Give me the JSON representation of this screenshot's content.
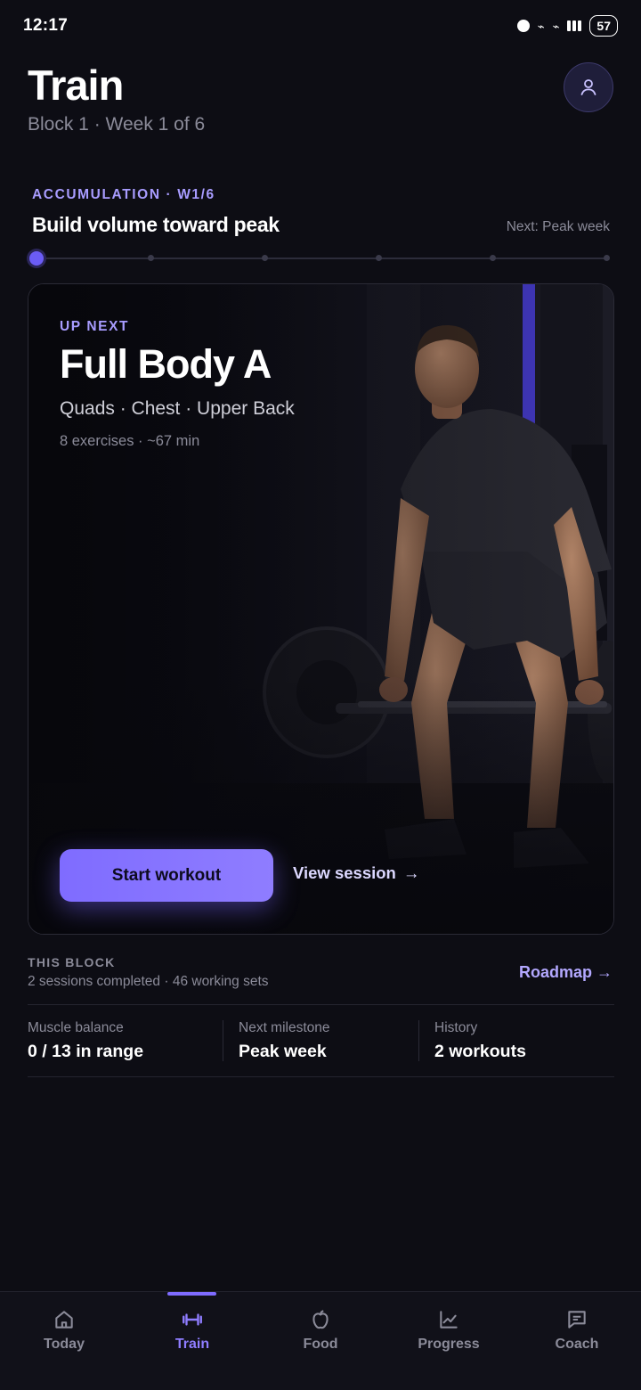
{
  "status_bar": {
    "time": "12:17",
    "battery": "57"
  },
  "header": {
    "title": "Train",
    "subtitle": "Block 1 · Week 1 of 6"
  },
  "phase": {
    "label": "ACCUMULATION · W1/6",
    "title": "Build volume toward peak",
    "next": "Next: Peak week",
    "current_step": 1,
    "total_steps": 6
  },
  "workout_card": {
    "label": "UP NEXT",
    "name": "Full Body A",
    "muscles": "Quads · Chest · Upper Back",
    "meta": "8 exercises · ~67 min",
    "start_label": "Start workout",
    "view_label": "View session",
    "view_arrow": "→"
  },
  "block": {
    "label": "THIS BLOCK",
    "summary": "2 sessions completed · 46 working sets",
    "roadmap_label": "Roadmap →"
  },
  "stats": [
    {
      "label": "Muscle balance",
      "value": "0 / 13 in range"
    },
    {
      "label": "Next milestone",
      "value": "Peak week"
    },
    {
      "label": "History",
      "value": "2 workouts"
    }
  ],
  "nav": {
    "active": "Train",
    "items": [
      {
        "label": "Today",
        "icon": "home-icon"
      },
      {
        "label": "Train",
        "icon": "dumbbell-icon"
      },
      {
        "label": "Food",
        "icon": "apple-icon"
      },
      {
        "label": "Progress",
        "icon": "chart-icon"
      },
      {
        "label": "Coach",
        "icon": "chat-icon"
      }
    ]
  },
  "colors": {
    "accent": "#8f7dff",
    "background": "#0d0d14",
    "muted": "#8b8b99"
  }
}
